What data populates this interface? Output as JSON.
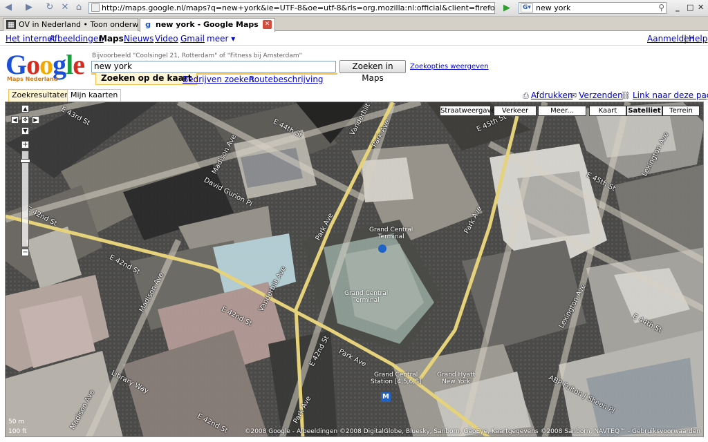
{
  "browser": {
    "url": "http://maps.google.nl/maps?q=new+york&ie=UTF-8&oe=utf-8&rls=org.mozilla:nl:official&client=firefox-a&um=1&sa=X&oi=geo",
    "search_value": "new york",
    "window_controls": {
      "minimize": "_",
      "maximize": "□",
      "close": "✕"
    },
    "tabs": [
      {
        "label": "OV in Nederland • Toon onderwerp...",
        "icon": "forum-icon",
        "active": false
      },
      {
        "label": "new york - Google Maps",
        "icon": "google-icon",
        "active": true
      }
    ]
  },
  "google_nav": {
    "items": [
      "Het internet",
      "Afbeeldingen",
      "Maps",
      "Nieuws",
      "Video",
      "Gmail",
      "meer ▾"
    ],
    "current": "Maps",
    "signin": "Aanmelden",
    "help": "Help",
    "separator": "|"
  },
  "logo": {
    "text": "Google",
    "subtitle": "Maps Nederland"
  },
  "search": {
    "example": "Bijvoorbeeld \"Coolsingel 21, Rotterdam\" of \"Fitness bij Amsterdam\"",
    "value": "new york",
    "button": "Zoeken in Maps",
    "options": "Zoekopties weergeven",
    "tabs": [
      "Zoeken op de kaart",
      "Bedrijven zoeken",
      "Routebeschrijving"
    ]
  },
  "side_tabs": [
    "Zoekresultaten",
    "Mijn kaarten"
  ],
  "map_links": {
    "print": "Afdrukken",
    "send": "Verzenden",
    "link": "Link naar deze pagina"
  },
  "map": {
    "left_buttons": [
      "Straatweergave",
      "Verkeer",
      "Meer..."
    ],
    "type_buttons": [
      "Kaart",
      "Satelliet",
      "Terrein"
    ],
    "selected_type": "Satelliet",
    "scale": [
      "50 m",
      "100 ft"
    ],
    "copyright": "©2008 Google - Afbeeldingen ©2008 DigitalGlobe, Bluesky, Sanborn, GeoEye, Kaartgegevens ©2008 Sanborn, NAVTEQ™ - Gebruiksvoorwaarden",
    "zoom": {
      "in": "+",
      "out": "−"
    },
    "labels": {
      "e43": "E 43rd St",
      "e44a": "E 44th St",
      "e45": "E 45th St",
      "e45b": "E 45th St",
      "e44b": "E 44th St",
      "e42a": "E 42nd St",
      "e42b": "E 42nd St",
      "e42c": "E 42nd St",
      "e42d": "E 42nd St",
      "e42e": "E 42nd St",
      "madison1": "Madison Ave",
      "madison2": "Madison Ave",
      "madison3": "Madison Ave",
      "vanderbilt1": "Vanderbilt Ave",
      "vanderbilt2": "Vanderbilt Ave",
      "park1": "Park Ave",
      "park2": "Park Ave",
      "park3": "Park Ave",
      "park4": "Park Ave",
      "park5": "Park Ave",
      "lexington1": "Lexington Ave",
      "lexington2": "Lexington Ave",
      "davidgurion": "David Gurion Pl",
      "library": "Library Way",
      "abp": "ABP Fulton J Sheen Pl",
      "gct_terminal": "Grand Central Terminal",
      "gct_a": "Grand Central",
      "gct_b": "Terminal",
      "gct_station_a": "Grand Central",
      "gct_station_b": "Station [4,5,6,S]",
      "hyatt_a": "Grand Hyatt",
      "hyatt_b": "New York",
      "gct_top_a": "Grand Central",
      "gct_top_b": "Terminal",
      "metro": "M"
    }
  }
}
